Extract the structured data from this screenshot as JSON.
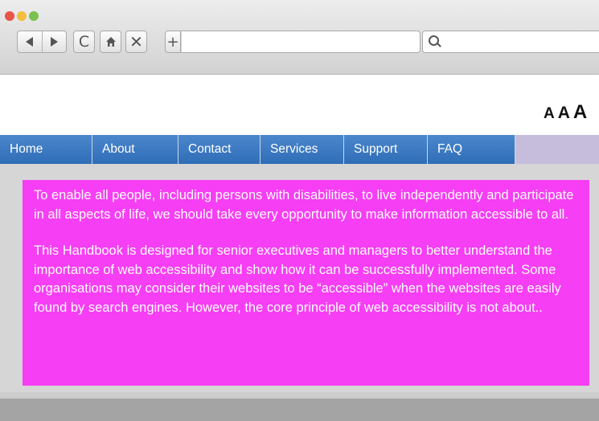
{
  "browser": {
    "icons": {
      "back": "back-arrow-icon",
      "forward": "forward-arrow-icon",
      "reload": "reload-icon",
      "home": "home-icon",
      "stop": "close-icon",
      "new_tab": "plus-icon",
      "search": "search-icon"
    },
    "reload_glyph": "C",
    "home_glyph": "⌂",
    "stop_glyph": "✕",
    "new_tab_glyph": "+",
    "address_value": "",
    "search_value": ""
  },
  "header": {
    "text_size": [
      "A",
      "A",
      "A"
    ]
  },
  "nav": {
    "items": [
      "Home",
      "About",
      "Contact",
      "Services",
      "Support",
      "FAQ"
    ]
  },
  "content": {
    "paragraphs": [
      "To enable all people, including persons with disabilities, to live independently and participate in all aspects of life, we should take every opportunity to make information accessible to all.",
      "This Handbook is designed for senior executives and managers to better understand the importance of web accessibility and show how it can be successfully implemented. Some organisations may consider their websites to be “accessible” when the websites are easily found by search engines. However, the core principle of web accessibility is not about.."
    ]
  },
  "colors": {
    "nav_bg": "#2f6db7",
    "content_bg": "#f63ef4",
    "body_bg": "#d6d6d6"
  }
}
